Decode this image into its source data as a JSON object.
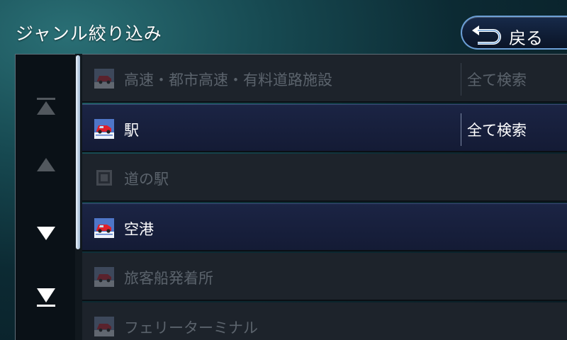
{
  "header": {
    "title": "ジャンル絞り込み",
    "back_label": "戻る"
  },
  "nav": {
    "buttons": [
      {
        "icon": "scroll-to-top-icon",
        "enabled": false
      },
      {
        "icon": "scroll-up-icon",
        "enabled": false
      },
      {
        "icon": "scroll-down-icon",
        "enabled": true
      },
      {
        "icon": "scroll-to-bottom-icon",
        "enabled": true
      }
    ]
  },
  "list": {
    "items": [
      {
        "label": "高速・都市高速・有料道路施設",
        "action": "全て検索",
        "icon": "car-category-icon",
        "enabled": false
      },
      {
        "label": "駅",
        "action": "全て検索",
        "icon": "car-category-icon",
        "enabled": true
      },
      {
        "label": "道の駅",
        "action": "",
        "icon": "michi-no-eki-icon",
        "enabled": false
      },
      {
        "label": "空港",
        "action": "",
        "icon": "car-category-icon",
        "enabled": true
      },
      {
        "label": "旅客船発着所",
        "action": "",
        "icon": "car-category-icon",
        "enabled": false
      },
      {
        "label": "フェリーターミナル",
        "action": "",
        "icon": "car-category-icon",
        "enabled": false
      }
    ]
  },
  "colors": {
    "accent_border": "#6c9fd6",
    "enabled_row": "#1b2444",
    "disabled_row": "#1d232b",
    "disabled_text": "#5b636c"
  }
}
